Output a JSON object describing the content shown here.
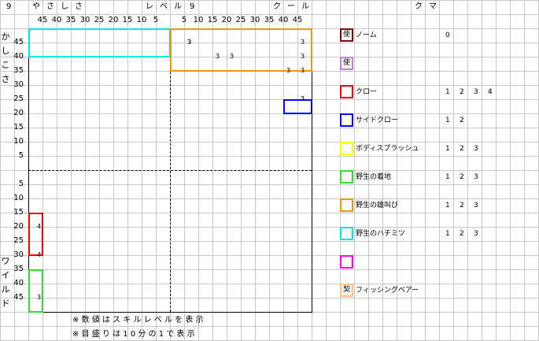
{
  "header": {
    "left_level": "9",
    "left_name_chars": [
      "や",
      "さ",
      "し",
      "さ"
    ],
    "level_word_chars": [
      "レ",
      "ベ",
      "ル"
    ],
    "right_level": "9",
    "right_name_chars": [
      "ク",
      "ー",
      "ル"
    ],
    "legend_title_chars": [
      "ク",
      "マ"
    ]
  },
  "x_ticks_left": [
    "45",
    "40",
    "35",
    "30",
    "25",
    "20",
    "15",
    "10",
    "5"
  ],
  "x_ticks_right": [
    "5",
    "10",
    "15",
    "20",
    "25",
    "30",
    "35",
    "40",
    "45"
  ],
  "y_ticks_top": [
    "45",
    "40",
    "35",
    "30",
    "25",
    "20",
    "15",
    "10",
    "5"
  ],
  "y_ticks_bottom": [
    "5",
    "10",
    "15",
    "20",
    "25",
    "30",
    "35",
    "40",
    "45"
  ],
  "y_axis_top_label": [
    "か",
    "し",
    "こ",
    "さ"
  ],
  "y_axis_bottom_label": [
    "ワ",
    "イ",
    "ル",
    "ド"
  ],
  "footnotes": [
    "※ 数 値 は ス キ ル レ ベ ル を 表 示",
    "※ 目 盛 り は 1 0 分 の 1 で 表 示"
  ],
  "chart_data": {
    "type": "scatter",
    "x_axis": {
      "left_label": "やさしさ",
      "right_label": "クール",
      "range": [
        -45,
        45
      ]
    },
    "y_axis": {
      "top_label": "かしこさ",
      "bottom_label": "ワイルド",
      "range": [
        -45,
        45
      ]
    },
    "regions": [
      {
        "skill": "野生のハチミツ",
        "color": "#00e5e5",
        "x_range": [
          -50,
          0
        ],
        "y_range": [
          40,
          50
        ],
        "labels": [
          {
            "x": 5,
            "y": 45,
            "text": "3"
          }
        ]
      },
      {
        "skill": "野生の雄叫び",
        "color": "#f0960a",
        "x_range": [
          0,
          50
        ],
        "y_range": [
          35,
          50
        ],
        "labels": [
          {
            "x": 5,
            "y": 45,
            "text": "3"
          },
          {
            "x": 45,
            "y": 45,
            "text": "3"
          },
          {
            "x": 15,
            "y": 40,
            "text": "3"
          },
          {
            "x": 20,
            "y": 40,
            "text": "3"
          },
          {
            "x": 45,
            "y": 40,
            "text": "3"
          },
          {
            "x": 40,
            "y": 35,
            "text": "3"
          },
          {
            "x": 45,
            "y": 35,
            "text": "3"
          }
        ]
      },
      {
        "skill": "サイドクロー",
        "color": "#0000ff",
        "x_range": [
          40,
          50
        ],
        "y_range": [
          20,
          25
        ],
        "labels": [
          {
            "x": 45,
            "y": 25,
            "text": "3"
          }
        ]
      },
      {
        "skill": "クロー",
        "color": "#ff0000",
        "x_range": [
          -50,
          -45
        ],
        "y_range": [
          -30,
          -15
        ],
        "labels": [
          {
            "x": -45,
            "y": -20,
            "text": "4"
          },
          {
            "x": -45,
            "y": -30,
            "text": "4"
          }
        ]
      },
      {
        "skill": "野生の着地",
        "color": "#33dd33",
        "x_range": [
          -50,
          -45
        ],
        "y_range": [
          -50,
          -35
        ],
        "labels": [
          {
            "x": -45,
            "y": -45,
            "text": "3"
          }
        ]
      }
    ]
  },
  "legend": [
    {
      "icon_char": "使",
      "name": "ノーム",
      "color": "#800000",
      "levels": [
        "0"
      ]
    },
    {
      "icon_char": "使",
      "name": "",
      "color": "#c080e0",
      "levels": []
    },
    {
      "icon_char": "",
      "name": "クロー",
      "color": "#ff0000",
      "levels": [
        "1",
        "2",
        "3",
        "4"
      ]
    },
    {
      "icon_char": "",
      "name": "サイドクロー",
      "color": "#0000ff",
      "levels": [
        "1",
        "2"
      ]
    },
    {
      "icon_char": "",
      "name": "ボディスプラッシュ",
      "color": "#ffff00",
      "levels": [
        "1",
        "2",
        "3"
      ]
    },
    {
      "icon_char": "",
      "name": "野生の着地",
      "color": "#33dd33",
      "levels": [
        "1",
        "2",
        "3"
      ]
    },
    {
      "icon_char": "",
      "name": "野生の雄叫び",
      "color": "#f0960a",
      "levels": [
        "1",
        "2",
        "3"
      ]
    },
    {
      "icon_char": "",
      "name": "野生のハチミツ",
      "color": "#00e5e5",
      "levels": [
        "1",
        "2",
        "3"
      ]
    },
    {
      "icon_char": "",
      "name": "",
      "color": "#ff00ff",
      "levels": []
    },
    {
      "icon_char": "契",
      "name": "フィッシングベアー",
      "color": "#ffc080",
      "levels": []
    }
  ]
}
